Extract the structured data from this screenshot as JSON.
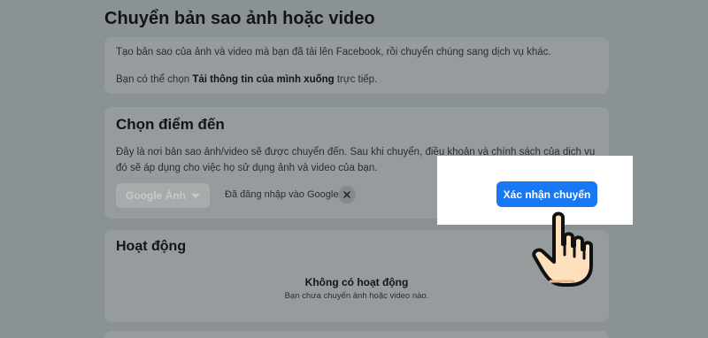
{
  "page": {
    "title": "Chuyển bản sao ảnh hoặc video"
  },
  "intro": {
    "line1": "Tạo bản sao của ảnh và video mà bạn đã tải lên Facebook, rồi chuyển chúng sang dịch vụ khác.",
    "line2_prefix": "Bạn có thể chọn ",
    "line2_bold": "Tải thông tin của mình xuống",
    "line2_suffix": " trực tiếp."
  },
  "destination": {
    "title": "Chọn điểm đến",
    "description": "Đây là nơi bản sao ảnh/video sẽ được chuyển đến. Sau khi chuyển, điều khoản và chính sách của dịch vụ đó sẽ áp dụng cho việc họ sử dụng ảnh và video của bạn.",
    "service_selected": "Google Ảnh",
    "logged_in_label": "Đã đăng nhập vào Google",
    "confirm_label": "Xác nhận chuyển"
  },
  "activity": {
    "title": "Hoạt động",
    "empty_title": "Không có hoạt động",
    "empty_subtitle": "Bạn chưa chuyển ảnh hoặc video nào."
  },
  "colors": {
    "accent": "#1877f2",
    "overlay": "#8a9294",
    "card": "#969c9d",
    "highlight": "#ffffff"
  },
  "icons": {
    "close": "close-icon",
    "dropdown": "chevron-down-icon",
    "pointer": "pointing-hand-icon"
  }
}
